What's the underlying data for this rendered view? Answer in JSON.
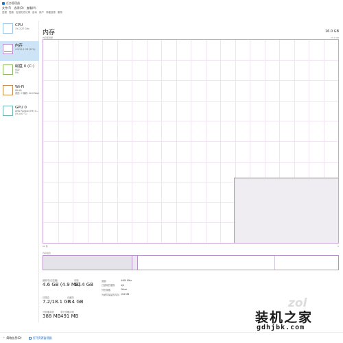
{
  "window": {
    "title": "任务管理器"
  },
  "menu": [
    "文件(F)",
    "选项(O)",
    "查看(V)"
  ],
  "tabs": [
    "进程",
    "性能",
    "应用历史记录",
    "启动",
    "用户",
    "详细信息",
    "服务"
  ],
  "sidebar": {
    "items": [
      {
        "title": "CPU",
        "sub": "1% 2.27 GHz"
      },
      {
        "title": "内存",
        "sub": "4.9/15.9 GB (32%)"
      },
      {
        "title": "磁盘 0 (C:)",
        "sub": "SSD",
        "sub2": "0%"
      },
      {
        "title": "Wi-Fi",
        "sub": "WLAN",
        "sub2": "发送: 0 接收: 40.0 Kbps"
      },
      {
        "title": "GPU 0",
        "sub": "AMD Radeon(TM) G...",
        "sub2": "0% (40 °C)"
      }
    ]
  },
  "main": {
    "title": "内存",
    "total": "16.0 GB",
    "usage_caption": "内存使用量",
    "max_caption": "15.9 GB",
    "axis_left": "60 秒",
    "axis_right": "0",
    "composition_caption": "内存组合"
  },
  "memory_history": {
    "before_pct": 0,
    "after_pct": 32
  },
  "memory_composition": {
    "used_fraction": 0.31,
    "standby_fraction": 0.47
  },
  "stats": {
    "in_use_label": "使用中(已压缩)",
    "in_use": "4.6 GB (4.9 MB)",
    "available_label": "可用",
    "available": "10.4 GB",
    "committed_label": "已提交",
    "committed": "7.2/18.1 GB",
    "cached_label": "已缓存",
    "cached": "7.4 GB",
    "paged_label": "分页缓冲池",
    "paged": "388 MB",
    "nonpaged_label": "非分页缓冲池",
    "nonpaged": "491 MB"
  },
  "properties": [
    {
      "label": "速度:",
      "value": "4400 MHz"
    },
    {
      "label": "已使用的插槽:",
      "value": "4/4"
    },
    {
      "label": "外形规格:",
      "value": "Other"
    },
    {
      "label": "为硬件保留的内存:",
      "value": "154 MB"
    }
  ],
  "statusbar": {
    "fewer_details": "简略信息(D)",
    "monitor_link": "打开资源监视器"
  },
  "watermark": {
    "zol": "zol",
    "cn": "装机之家",
    "url": "gdhjbk.com"
  },
  "colors": {
    "memory_accent": "#9b6fb4",
    "selected_bg": "#cde3f6",
    "link": "#2a6ab8"
  }
}
